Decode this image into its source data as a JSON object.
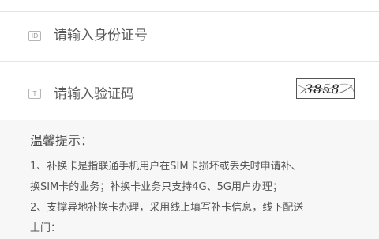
{
  "form": {
    "id_field": {
      "placeholder": "请输入身份证号",
      "icon": "id-card-icon"
    },
    "captcha_field": {
      "placeholder": "请输入验证码",
      "icon": "text-field-icon"
    },
    "captcha_image": {
      "text": "3858"
    }
  },
  "tips": {
    "title": "温馨提示：",
    "lines": [
      "1、补换卡是指联通手机用户在SIM卡损坏或丢失时申请补、",
      "换SIM卡的业务；补换卡业务只支持4G、5G用户办理；",
      "2、支撑异地补换卡办理，采用线上填写补卡信息，线下配送",
      "上门："
    ]
  }
}
